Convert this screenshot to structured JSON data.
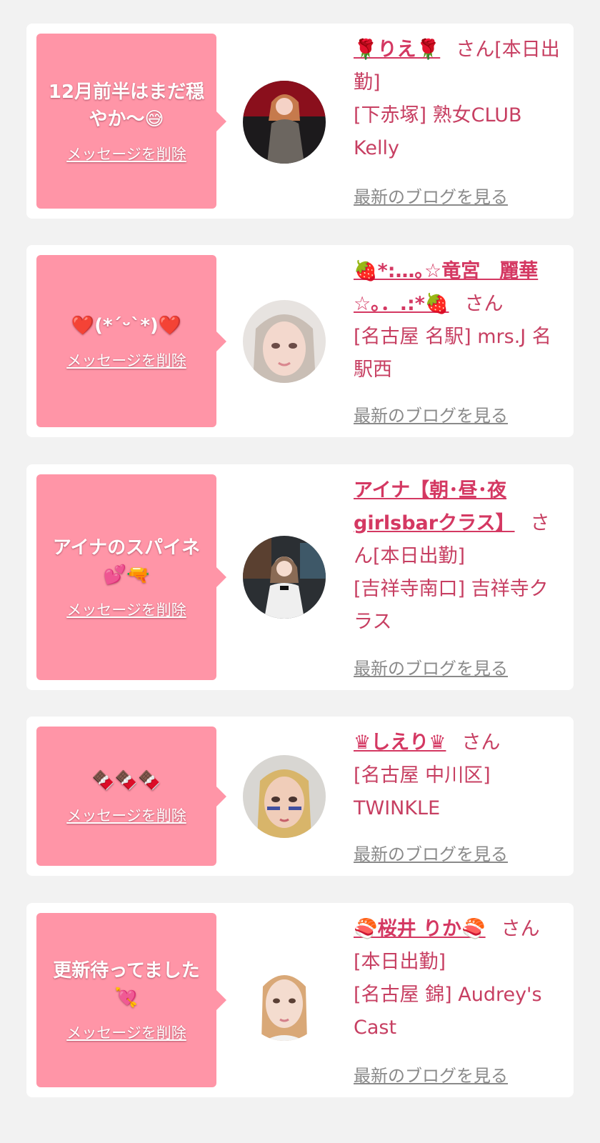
{
  "cards": [
    {
      "message": "12月前半はまだ穏やか〜😅",
      "delete_label": "メッセージを削除",
      "name": "🌹りえ🌹",
      "san": "さん",
      "status": "[本日出勤]",
      "shop": "[下赤塚] 熟女CLUB Kelly",
      "blog_label": "最新のブログを見る"
    },
    {
      "message": "❤️(*´ᵕ`*)❤️",
      "delete_label": "メッセージを削除",
      "name": "🍓*:…｡☆竜宮　麗華☆｡．.:*🍓",
      "san": "さん",
      "status": "",
      "shop": "[名古屋 名駅] mrs.J 名駅西",
      "blog_label": "最新のブログを見る"
    },
    {
      "message": "アイナのスパイネ💕🔫",
      "delete_label": "メッセージを削除",
      "name": "アイナ【朝･昼･夜girlsbarクラス】",
      "san": "さん",
      "status": "[本日出勤]",
      "shop": "[吉祥寺南口] 吉祥寺クラス",
      "blog_label": "最新のブログを見る"
    },
    {
      "message": "🍫🍫🍫",
      "delete_label": "メッセージを削除",
      "name": "♛しえり♛",
      "san": "さん",
      "status": "",
      "shop": "[名古屋 中川区] TWINKLE",
      "blog_label": "最新のブログを見る"
    },
    {
      "message": "更新待ってました💘",
      "delete_label": "メッセージを削除",
      "name": "🍣桜井 りか🍣",
      "san": "さん",
      "status": "[本日出勤]",
      "shop": "[名古屋 錦] Audrey's Cast",
      "blog_label": "最新のブログを見る"
    }
  ],
  "colors": {
    "page_bg": "#f2f2f2",
    "bubble": "#ff95a7",
    "name": "#d43862",
    "text": "#c73f62",
    "blog_link": "#8a8a8a"
  }
}
